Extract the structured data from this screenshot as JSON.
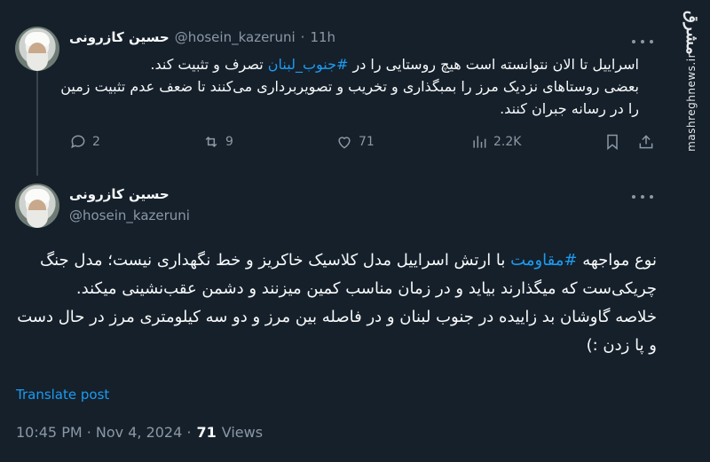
{
  "watermark": {
    "logo": "مشرق",
    "url": "mashreghnews.ir"
  },
  "tweet1": {
    "author_name": "حسین کازرونی",
    "handle": "@hosein_kazeruni",
    "separator": "·",
    "time": "11h",
    "line1_a": "اسراییل تا الان نتوانسته است هیچ روستایی را در ",
    "line1_hashtag": "#جنوب_لبنان",
    "line1_b": " تصرف و تثبیت کند.",
    "line2": "بعضی روستاهای نزدیک مرز را بمبگذاری و تخریب و تصویربرداری می‌کنند تا ضعف عدم تثبیت زمین را در رسانه جبران کنند.",
    "stats": {
      "replies": "2",
      "reposts": "9",
      "likes": "71",
      "views": "2.2K"
    }
  },
  "tweet2": {
    "author_name": "حسین کازرونی",
    "handle": "@hosein_kazeruni",
    "p1_a": "نوع مواجهه ",
    "p1_hashtag": "#مقاومت",
    "p1_b": " با ارتش اسراییل مدل کلاسیک خاکریز و خط نگهداری نیست؛ مدل جنگ چریکی‌ست که میگذارند بیاید و در زمان مناسب کمین میزنند و دشمن عقب‌نشینی میکند.",
    "p2": "خلاصه گاوشان بد زاییده در جنوب لبنان و در فاصله بین مرز و دو سه کیلومتری مرز در حال دست و پا زدن :)",
    "translate": "Translate post",
    "timestamp": "10:45 PM · Nov 4, 2024 ·",
    "views_count": "71",
    "views_label": "Views"
  },
  "icons": [
    "reply-icon",
    "repost-icon",
    "like-icon",
    "views-icon",
    "bookmark-icon",
    "share-icon",
    "more-icon"
  ]
}
